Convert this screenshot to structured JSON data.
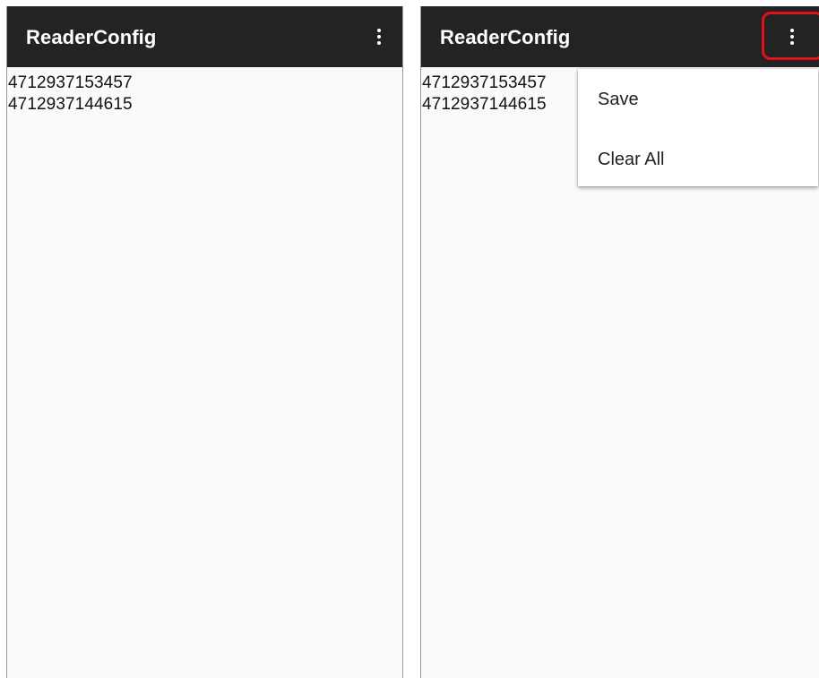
{
  "screens": [
    {
      "appbar": {
        "title": "ReaderConfig",
        "overflow_icon": "more-vert-icon"
      },
      "scans": [
        "4712937153457",
        "4712937144615"
      ]
    },
    {
      "appbar": {
        "title": "ReaderConfig",
        "overflow_icon": "more-vert-icon"
      },
      "scans": [
        "4712937153457",
        "4712937144615"
      ],
      "menu": {
        "items": [
          {
            "label": "Save"
          },
          {
            "label": "Clear All"
          }
        ]
      },
      "highlight_color": "#e0131b"
    }
  ],
  "colors": {
    "appbar": "#232323",
    "background": "#fafafa",
    "menu_background": "#ffffff"
  }
}
